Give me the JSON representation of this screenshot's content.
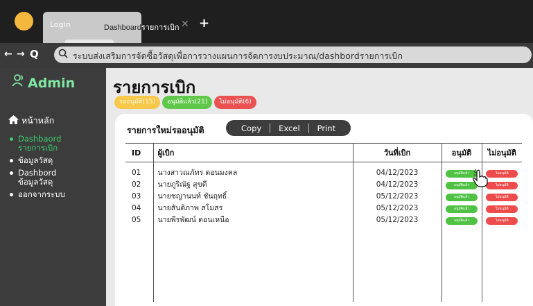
{
  "browser": {
    "tabs": [
      {
        "label": "Login"
      },
      {
        "label_prefix": "Dashboard",
        "label_suffix": "รายการเบิก"
      }
    ],
    "close_glyph": "✕",
    "new_tab_glyph": "+",
    "back_glyph": "←",
    "forward_glyph": "→",
    "reload_glyph": "Q",
    "url": "ระบบส่งเสริมการจัดซื้อวัสดุเพื่อการวางแผนการจัดการงบประมาณ/dashbordรายการเบิก"
  },
  "sidebar": {
    "brand": "Admin",
    "brand_icon": "users-icon",
    "home_label": "หน้าหลัก",
    "home_icon": "home-icon",
    "items": [
      {
        "label": "Dashbaord\nรายการเบิก",
        "active": true
      },
      {
        "label": "ข้อมูลวัสดุ",
        "active": false
      },
      {
        "label": "Dashbord\nข้อมูลวัสดุ",
        "active": false
      },
      {
        "label": "ออกจากระบบ",
        "active": false
      }
    ]
  },
  "main": {
    "title": "รายการเบิก",
    "badges": [
      {
        "label": "รออนุมัติ(15)",
        "color": "#f7c84a"
      },
      {
        "label": "อนุมัติแล้ว(21)",
        "color": "#5fc84a"
      },
      {
        "label": "ไม่อนุมัติ(6)",
        "color": "#ec5151"
      }
    ],
    "panel_title": "รายการใหม่รออนุมัติ",
    "export_buttons": [
      "Copy",
      "Excel",
      "Print"
    ],
    "columns": {
      "id": "ID",
      "name": "ผู้เบิก",
      "date": "วันที่เบิก",
      "approve": "อนุมัติ",
      "reject": "ไม่อนุมัติ"
    },
    "rows": [
      {
        "id": "01",
        "name": "นางสาวณภัทร ดอนมงคล",
        "date": "04/12/2023",
        "approve": "อนุมัติแล้ว",
        "reject": "ไม่อนุมัติ"
      },
      {
        "id": "02",
        "name": "นายภูริณัฐ สุขดี",
        "date": "04/12/2023",
        "approve": "อนุมัติแล้ว",
        "reject": "ไม่อนุมัติ"
      },
      {
        "id": "03",
        "name": "นายชญานนท์ ชันฤทธิ์",
        "date": "05/12/2023",
        "approve": "อนุมัติแล้ว",
        "reject": "ไม่อนุมัติ"
      },
      {
        "id": "04",
        "name": "นายสันติภาพ สโมสร",
        "date": "05/12/2023",
        "approve": "อนุมัติแล้ว",
        "reject": "ไม่อนุมัติ"
      },
      {
        "id": "05",
        "name": "นายพีรพัฒน์ ดอนเหนือ",
        "date": "05/12/2023",
        "approve": "อนุมัติแล้ว",
        "reject": "ไม่อนุมัติ"
      }
    ]
  },
  "colors": {
    "accent_green": "#3ad06b",
    "approve": "#4fc244",
    "reject": "#ee4c4c",
    "pending": "#f7c84a"
  }
}
